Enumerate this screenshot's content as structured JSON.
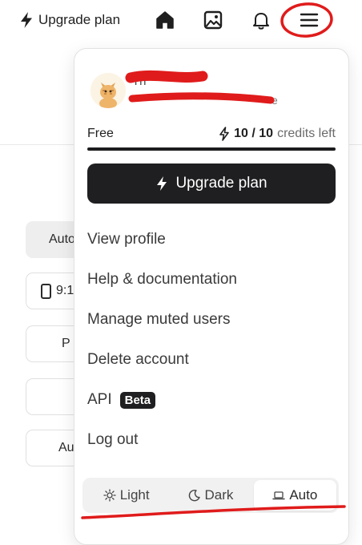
{
  "topbar": {
    "upgrade_label": "Upgrade plan",
    "icons": [
      "bolt-icon",
      "home-icon",
      "image-icon",
      "bell-icon",
      "menu-icon"
    ]
  },
  "background": {
    "items": [
      "Auto",
      "9:1",
      "P",
      "",
      "Au"
    ]
  },
  "dropdown": {
    "user": {
      "name_visible": "Th",
      "email_visible": "e"
    },
    "plan": {
      "name": "Free",
      "credits_value": "10 / 10",
      "credits_label": "credits left",
      "credits_remaining_fraction": 1.0
    },
    "upgrade_button_label": "Upgrade plan",
    "menu": [
      {
        "label": "View profile"
      },
      {
        "label": "Help & documentation"
      },
      {
        "label": "Manage muted users"
      },
      {
        "label": "Delete account"
      },
      {
        "label": "API",
        "badge": "Beta"
      },
      {
        "label": "Log out"
      }
    ],
    "theme": {
      "options": [
        "Light",
        "Dark",
        "Auto"
      ],
      "selected": "Auto"
    }
  },
  "colors": {
    "primary_dark": "#1f1f21",
    "annotation_red": "#e01b1b",
    "muted_text": "#6b6b6b"
  }
}
